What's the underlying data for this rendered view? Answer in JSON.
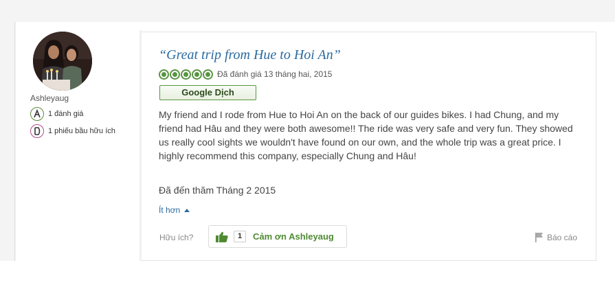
{
  "member": {
    "username": "Ashleyaug",
    "badges": [
      {
        "icon": "review-badge-icon",
        "text": "1 đánh giá"
      },
      {
        "icon": "helpful-vote-badge-icon",
        "text": "1 phiếu bầu hữu ích"
      }
    ]
  },
  "review": {
    "title": "“Great trip from Hue to Hoi An”",
    "rating": 5,
    "rating_max": 5,
    "rating_date": "Đã đánh giá 13 tháng hai, 2015",
    "translate_label": "Google Dịch",
    "body": "My friend and I rode from Hue to Hoi An on the back of our guides bikes. I had Chung, and my friend had Hâu and they were both awesome!! The ride was very safe and very fun. They showed us really cool sights we wouldn't have found on our own, and the whole trip was a great price. I highly recommend this company, especially Chung and Hâu!",
    "visit_date": "Đã đến thăm Tháng 2 2015",
    "less_label": "Ít hơn",
    "helpful_label": "Hữu ích?",
    "thanks_count": "1",
    "thanks_label": "Cảm ơn Ashleyaug",
    "report_label": "Báo cáo"
  },
  "colors": {
    "accent_blue": "#2a6aa0",
    "rating_green": "#589442",
    "thanks_green": "#4f8a33"
  }
}
